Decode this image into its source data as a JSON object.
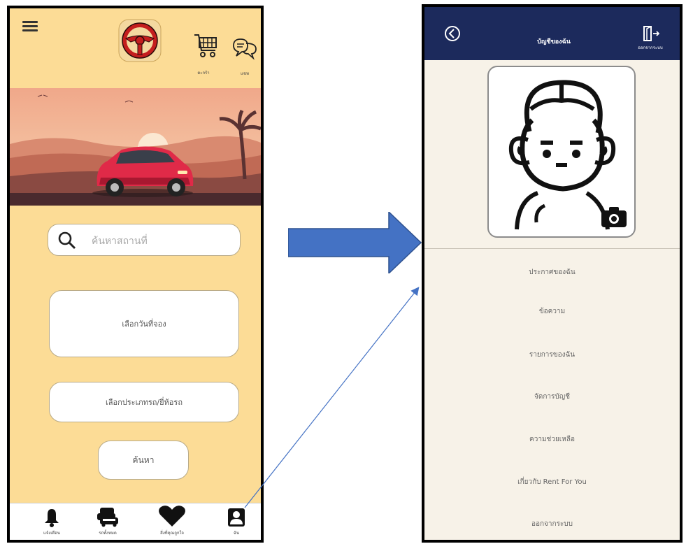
{
  "left_screen": {
    "header": {
      "cart_label": "ตะกร้า",
      "chat_label": "แชท"
    },
    "search": {
      "placeholder": "ค้นหาสถานที่"
    },
    "buttons": {
      "select_date": "เลือกวันที่จอง",
      "select_car_type": "เลือกประเภทรถ/ยี่ห้อรถ",
      "search": "ค้นหา"
    },
    "bottom_nav": [
      {
        "label": "แจ้งเตือน",
        "icon": "bell-icon"
      },
      {
        "label": "รถทั้งหมด",
        "icon": "cars-icon"
      },
      {
        "label": "สิ่งที่คุณถูกใจ",
        "icon": "heart-icon"
      },
      {
        "label": "ฉัน",
        "icon": "profile-icon"
      }
    ]
  },
  "right_screen": {
    "header": {
      "title": "บัญชีของฉัน",
      "logout_label": "ออกจากระบบ"
    },
    "menu": [
      "ประกาศของฉัน",
      "ข้อความ",
      "รายการของฉัน",
      "จัดการบัญชี",
      "ความช่วยเหลือ",
      "เกี่ยวกับ Rent For You",
      "ออกจากระบบ"
    ]
  },
  "colors": {
    "left_background": "#fcdc96",
    "right_header": "#1c2a5c",
    "right_background": "#f7f2e8",
    "arrow": "#4472c4"
  }
}
